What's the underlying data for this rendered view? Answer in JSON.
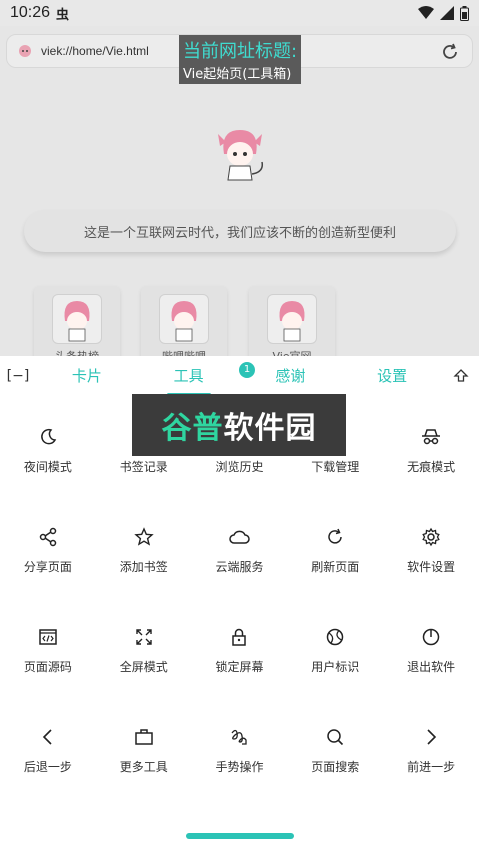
{
  "status_bar": {
    "time": "10:26",
    "extra": "虫",
    "icons": [
      "wifi-icon",
      "signal-icon",
      "battery-icon"
    ]
  },
  "browser": {
    "url": "viek://home/Vie.html",
    "title_tip_heading": "当前网址标题:",
    "title_tip_value": "Vie起始页(工具箱)",
    "slogan": "这是一个互联网云时代，我们应该不断的创造新型便利",
    "cards": [
      {
        "label": "头条热榜"
      },
      {
        "label": "哔哩哔哩"
      },
      {
        "label": "Vie官网"
      }
    ]
  },
  "panel": {
    "left_button": "[−]",
    "tabs": [
      {
        "label": "卡片"
      },
      {
        "label": "工具"
      },
      {
        "label": "感谢"
      },
      {
        "label": "设置"
      }
    ],
    "badge": "1",
    "watermark": {
      "part1": "谷普",
      "part2": "软件园"
    },
    "tools": [
      {
        "label": "夜间模式",
        "icon": "moon-icon"
      },
      {
        "label": "书签记录",
        "icon": "bookmark-list-icon"
      },
      {
        "label": "浏览历史",
        "icon": "history-icon"
      },
      {
        "label": "下载管理",
        "icon": "download-icon"
      },
      {
        "label": "无痕模式",
        "icon": "incognito-icon"
      },
      {
        "label": "分享页面",
        "icon": "share-icon"
      },
      {
        "label": "添加书签",
        "icon": "star-icon"
      },
      {
        "label": "云端服务",
        "icon": "cloud-icon"
      },
      {
        "label": "刷新页面",
        "icon": "refresh-icon"
      },
      {
        "label": "软件设置",
        "icon": "gear-icon"
      },
      {
        "label": "页面源码",
        "icon": "source-code-icon"
      },
      {
        "label": "全屏模式",
        "icon": "fullscreen-icon"
      },
      {
        "label": "锁定屏幕",
        "icon": "lock-icon"
      },
      {
        "label": "用户标识",
        "icon": "globe-icon"
      },
      {
        "label": "退出软件",
        "icon": "power-icon"
      },
      {
        "label": "后退一步",
        "icon": "chevron-left-icon"
      },
      {
        "label": "更多工具",
        "icon": "briefcase-icon"
      },
      {
        "label": "手势操作",
        "icon": "gesture-icon"
      },
      {
        "label": "页面搜索",
        "icon": "search-icon"
      },
      {
        "label": "前进一步",
        "icon": "chevron-right-icon"
      }
    ]
  },
  "colors": {
    "accent": "#2bc3b6",
    "watermark_green": "#2fd6a0"
  }
}
